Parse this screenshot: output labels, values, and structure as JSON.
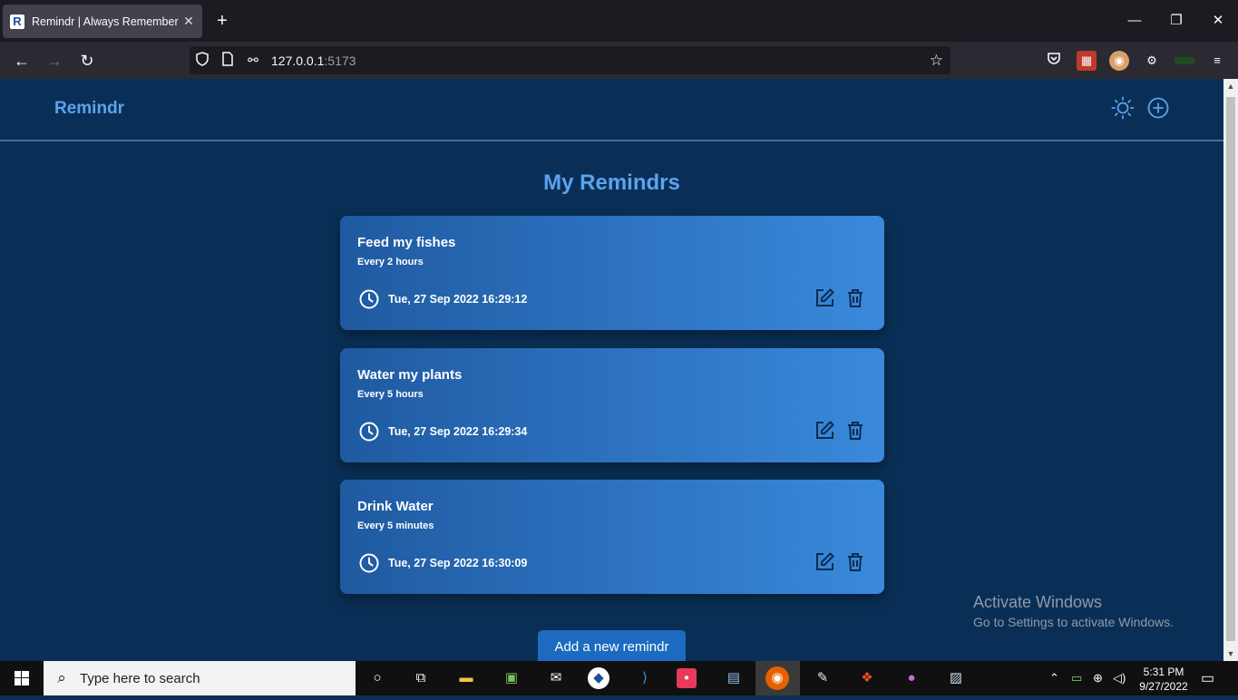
{
  "browser": {
    "tab_title": "Remindr | Always Remember",
    "tab_favicon": "R",
    "url_host": "127.0.0.1",
    "url_port": ":5173"
  },
  "app": {
    "logo": "Remindr",
    "page_title": "My Remindrs",
    "add_button": "Add a new remindr",
    "reminders": [
      {
        "title": "Feed my fishes",
        "frequency": "Every 2 hours",
        "datetime": "Tue, 27 Sep 2022 16:29:12"
      },
      {
        "title": "Water my plants",
        "frequency": "Every 5 hours",
        "datetime": "Tue, 27 Sep 2022 16:29:34"
      },
      {
        "title": "Drink Water",
        "frequency": "Every 5 minutes",
        "datetime": "Tue, 27 Sep 2022 16:30:09"
      }
    ]
  },
  "watermark": {
    "line1": "Activate Windows",
    "line2": "Go to Settings to activate Windows."
  },
  "taskbar": {
    "search_placeholder": "Type here to search",
    "time": "5:31 PM",
    "date": "9/27/2022"
  },
  "colors": {
    "app_bg": "#0a2f56",
    "accent": "#5ba3ef",
    "card_start": "#1f5aa1",
    "card_end": "#3a89dc",
    "button": "#1c6bc1"
  }
}
